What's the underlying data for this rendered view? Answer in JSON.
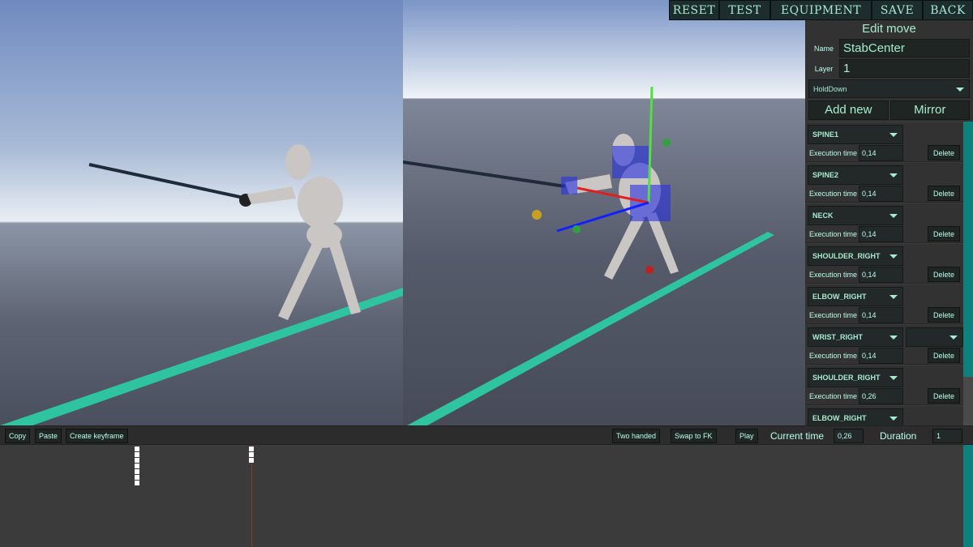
{
  "top_menu": [
    "RESET",
    "TEST",
    "EQUIPMENT",
    "SAVE",
    "BACK"
  ],
  "panel": {
    "title": "Edit move",
    "name_label": "Name",
    "name_value": "StabCenter",
    "layer_label": "Layer",
    "layer_value": "1",
    "hold_mode": "HoldDown",
    "add_new": "Add new",
    "mirror": "Mirror",
    "execution_label": "Execution time",
    "delete_label": "Delete",
    "bones": [
      {
        "bone": "SPINE1",
        "time": "0,14"
      },
      {
        "bone": "SPINE2",
        "time": "0,14"
      },
      {
        "bone": "NECK",
        "time": "0,14"
      },
      {
        "bone": "SHOULDER_RIGHT",
        "time": "0,14"
      },
      {
        "bone": "ELBOW_RIGHT",
        "time": "0,14"
      },
      {
        "bone": "WRIST_RIGHT",
        "time": "0,14"
      },
      {
        "bone": "SHOULDER_RIGHT",
        "time": "0,26"
      },
      {
        "bone": "ELBOW_RIGHT",
        "time": ""
      }
    ]
  },
  "toolbar": {
    "copy": "Copy",
    "paste": "Paste",
    "create_keyframe": "Create keyframe",
    "two_handed": "Two handed",
    "swap_fk": "Swap to FK",
    "play": "Play",
    "current_time_label": "Current time",
    "current_time": "0,26",
    "duration_label": "Duration",
    "duration": "1"
  },
  "colors": {
    "accent": "#a8ecd0",
    "scrollbar": "#10807c",
    "ground_line": "#2ec4a0",
    "playhead": "#8a3a2a"
  }
}
